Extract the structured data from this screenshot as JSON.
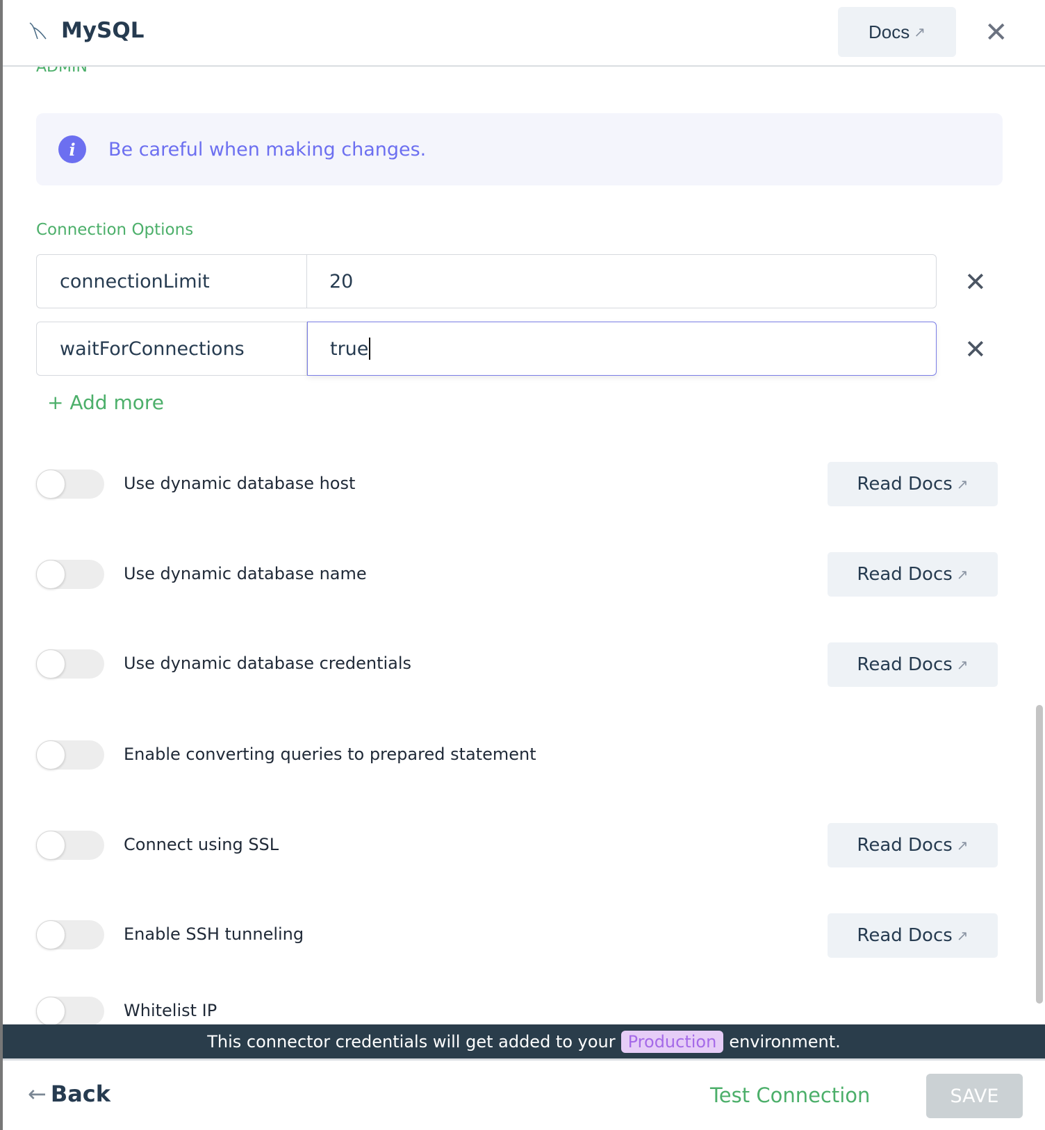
{
  "header": {
    "title": "MySQL",
    "docs_label": "Docs"
  },
  "section_partial": "ADMIN",
  "info": {
    "text": "Be careful when making changes."
  },
  "connection_options": {
    "label": "Connection Options",
    "rows": [
      {
        "key": "connectionLimit",
        "value": "20"
      },
      {
        "key": "waitForConnections",
        "value": "true"
      }
    ],
    "add_more": "+ Add more"
  },
  "toggles": [
    {
      "label": "Use dynamic database host",
      "docs": "Read Docs",
      "on": false
    },
    {
      "label": "Use dynamic database name",
      "docs": "Read Docs",
      "on": false
    },
    {
      "label": "Use dynamic database credentials",
      "docs": "Read Docs",
      "on": false
    },
    {
      "label": "Enable converting queries to prepared statement",
      "on": false
    },
    {
      "label": "Connect using SSL",
      "docs": "Read Docs",
      "on": false
    },
    {
      "label": "Enable SSH tunneling",
      "docs": "Read Docs",
      "on": false
    },
    {
      "label": "Whitelist IP",
      "on": false
    }
  ],
  "banner": {
    "before": "This connector credentials will get added to your",
    "env": "Production",
    "after": "environment."
  },
  "footer": {
    "back": "Back",
    "test": "Test Connection",
    "save": "SAVE"
  }
}
